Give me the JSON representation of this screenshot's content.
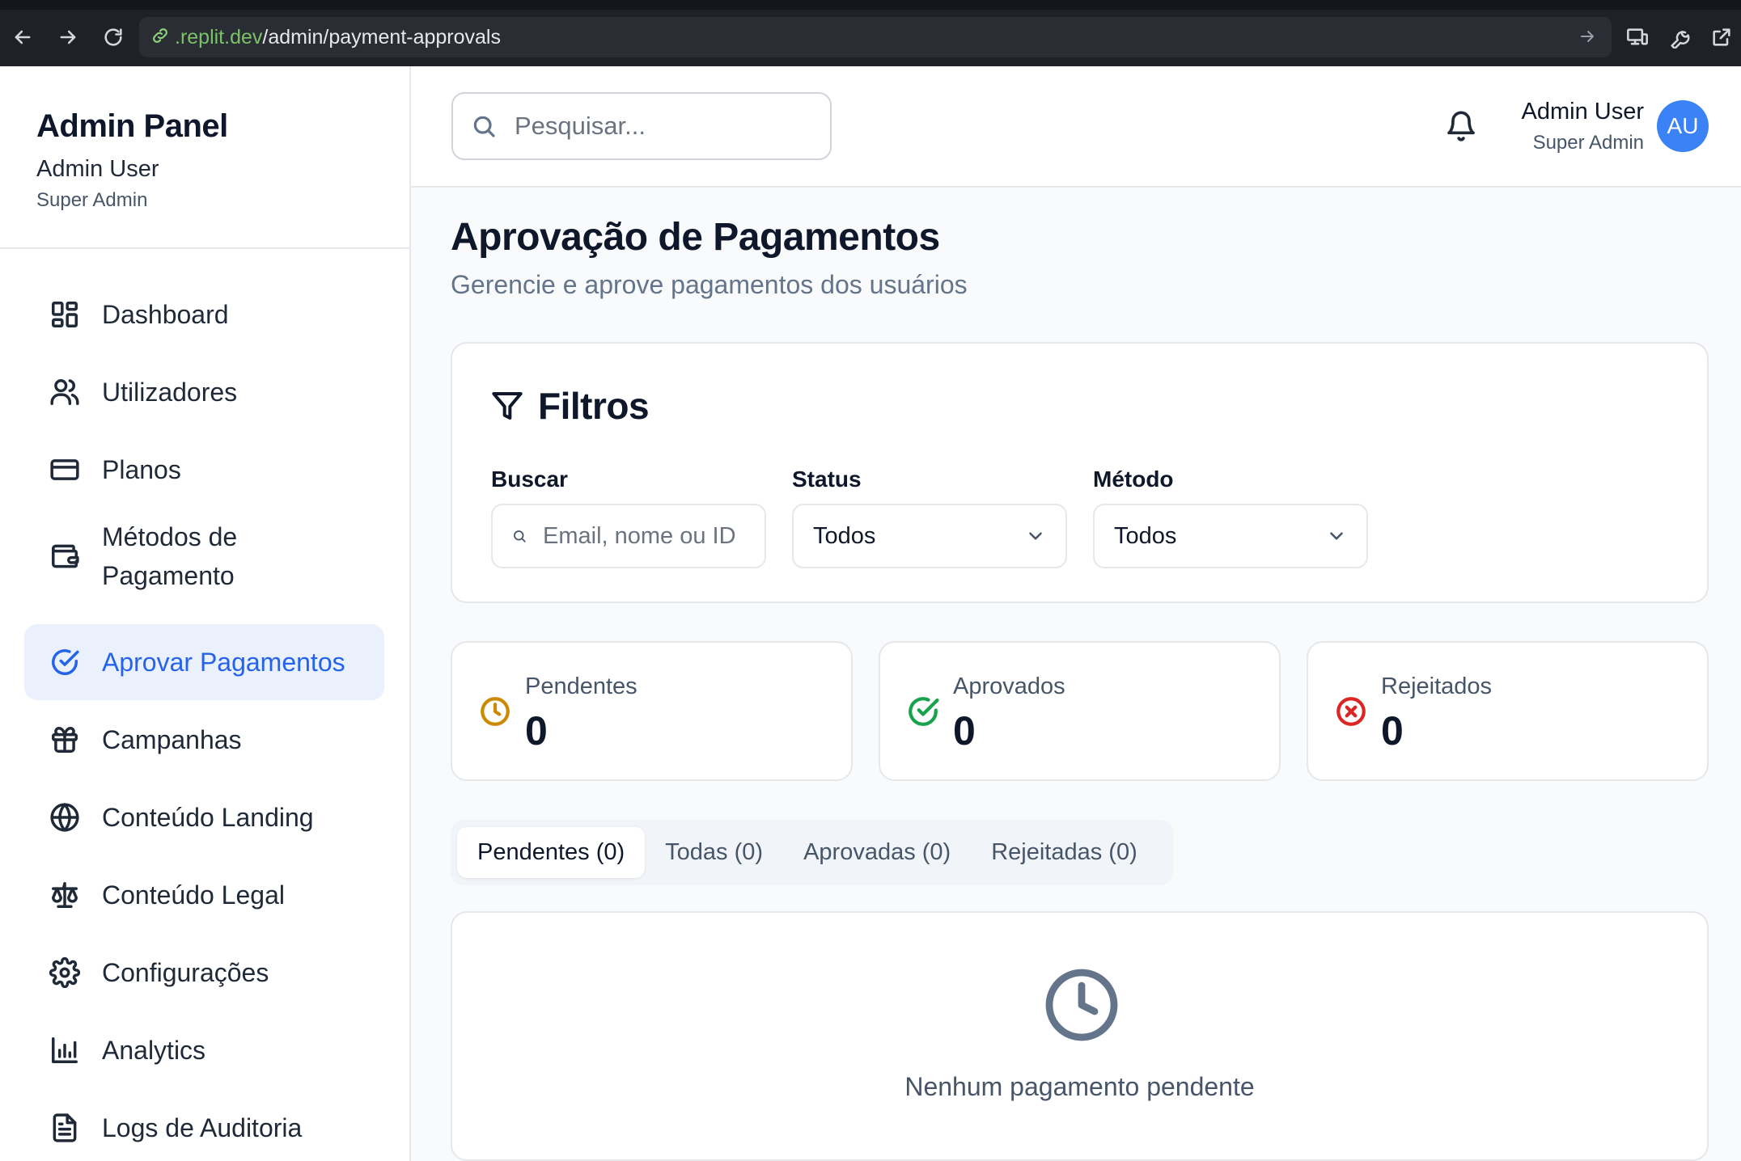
{
  "browser": {
    "url_host": ".replit.dev",
    "url_path": "/admin/payment-approvals"
  },
  "sidebar": {
    "title": "Admin Panel",
    "user_name": "Admin User",
    "user_role": "Super Admin",
    "items": [
      {
        "label": "Dashboard",
        "icon": "dashboard-icon"
      },
      {
        "label": "Utilizadores",
        "icon": "users-icon"
      },
      {
        "label": "Planos",
        "icon": "credit-card-icon"
      },
      {
        "label": "Métodos de Pagamento",
        "icon": "wallet-icon"
      },
      {
        "label": "Aprovar Pagamentos",
        "icon": "check-circle-icon",
        "active": true
      },
      {
        "label": "Campanhas",
        "icon": "gift-icon"
      },
      {
        "label": "Conteúdo Landing",
        "icon": "globe-icon"
      },
      {
        "label": "Conteúdo Legal",
        "icon": "scale-icon"
      },
      {
        "label": "Configurações",
        "icon": "gear-icon"
      },
      {
        "label": "Analytics",
        "icon": "bar-chart-icon"
      },
      {
        "label": "Logs de Auditoria",
        "icon": "file-text-icon"
      }
    ]
  },
  "topbar": {
    "search_placeholder": "Pesquisar...",
    "user_name": "Admin User",
    "user_role": "Super Admin",
    "avatar_initials": "AU"
  },
  "page": {
    "title": "Aprovação de Pagamentos",
    "subtitle": "Gerencie e aprove pagamentos dos usuários"
  },
  "filters": {
    "title": "Filtros",
    "search_label": "Buscar",
    "search_placeholder": "Email, nome ou ID",
    "status_label": "Status",
    "status_value": "Todos",
    "method_label": "Método",
    "method_value": "Todos"
  },
  "stats": [
    {
      "label": "Pendentes",
      "value": "0",
      "color": "#ca8a04"
    },
    {
      "label": "Aprovados",
      "value": "0",
      "color": "#16a34a"
    },
    {
      "label": "Rejeitados",
      "value": "0",
      "color": "#dc2626"
    }
  ],
  "tabs": [
    {
      "label": "Pendentes (0)",
      "active": true
    },
    {
      "label": "Todas (0)"
    },
    {
      "label": "Aprovadas (0)"
    },
    {
      "label": "Rejeitadas (0)"
    }
  ],
  "empty_state": {
    "message": "Nenhum pagamento pendente"
  },
  "colors": {
    "accent": "#2563eb",
    "avatar": "#3b82f6"
  }
}
